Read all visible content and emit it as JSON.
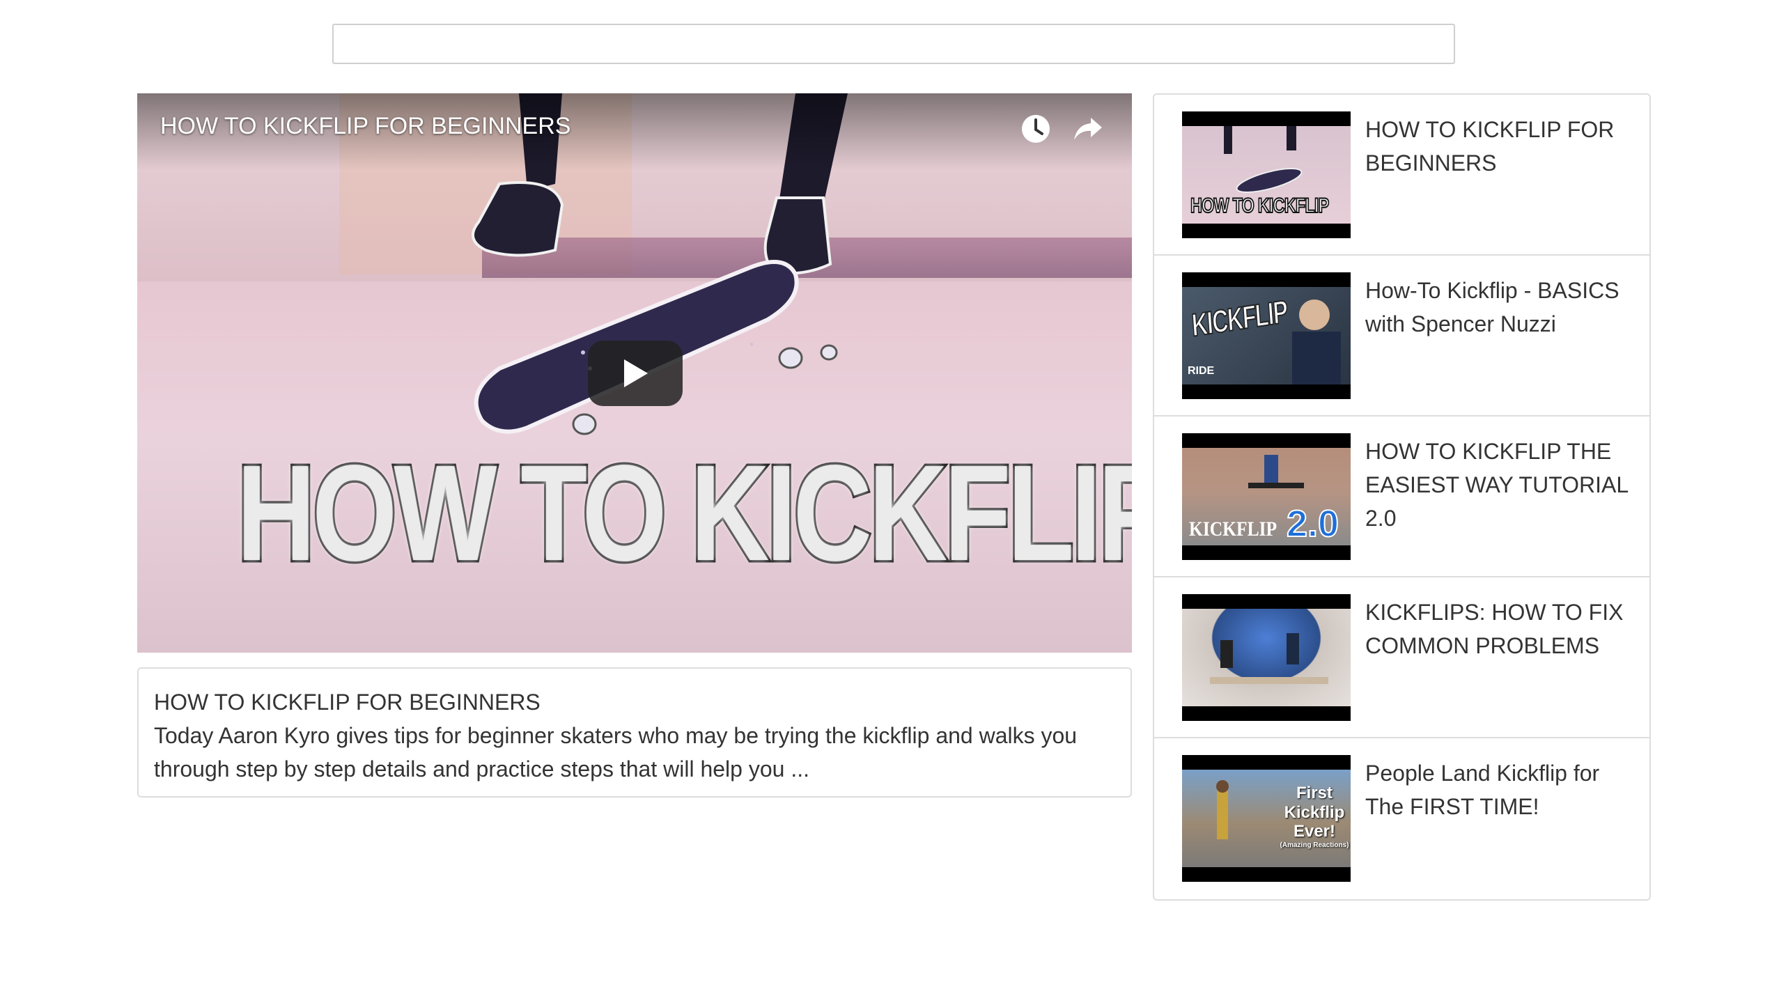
{
  "search": {
    "value": "",
    "placeholder": ""
  },
  "player": {
    "title": "HOW TO KICKFLIP FOR BEGINNERS",
    "caption": "HOW TO KICKFLIP",
    "icons": [
      "watch-later-icon",
      "share-icon",
      "play-icon"
    ]
  },
  "description": {
    "title": "HOW TO KICKFLIP FOR BEGINNERS",
    "text": "Today Aaron Kyro gives tips for beginner skaters who may be trying the kickflip and walks you through step by step details and practice steps that will help you ..."
  },
  "videos": [
    {
      "title": "HOW TO KICKFLIP FOR BEGINNERS",
      "thumb_text": "HOW TO KICKFLIP"
    },
    {
      "title": "How-To Kickflip - BASICS with Spencer Nuzzi",
      "thumb_text": "KICKFLIP",
      "thumb_badge": "RIDE"
    },
    {
      "title": "HOW TO KICKFLIP THE EASIEST WAY TUTORIAL 2.0",
      "thumb_text": "KICKFLIP",
      "thumb_badge": "2.0"
    },
    {
      "title": "KICKFLIPS: HOW TO FIX COMMON PROBLEMS"
    },
    {
      "title": "People Land Kickflip for The FIRST TIME!",
      "thumb_lines": [
        "First",
        "Kickflip",
        "Ever!",
        "(Amazing Reactions)"
      ]
    }
  ],
  "colors": {
    "border": "#dddddd",
    "text": "#333333",
    "badge_blue": "#1e6fd9"
  }
}
